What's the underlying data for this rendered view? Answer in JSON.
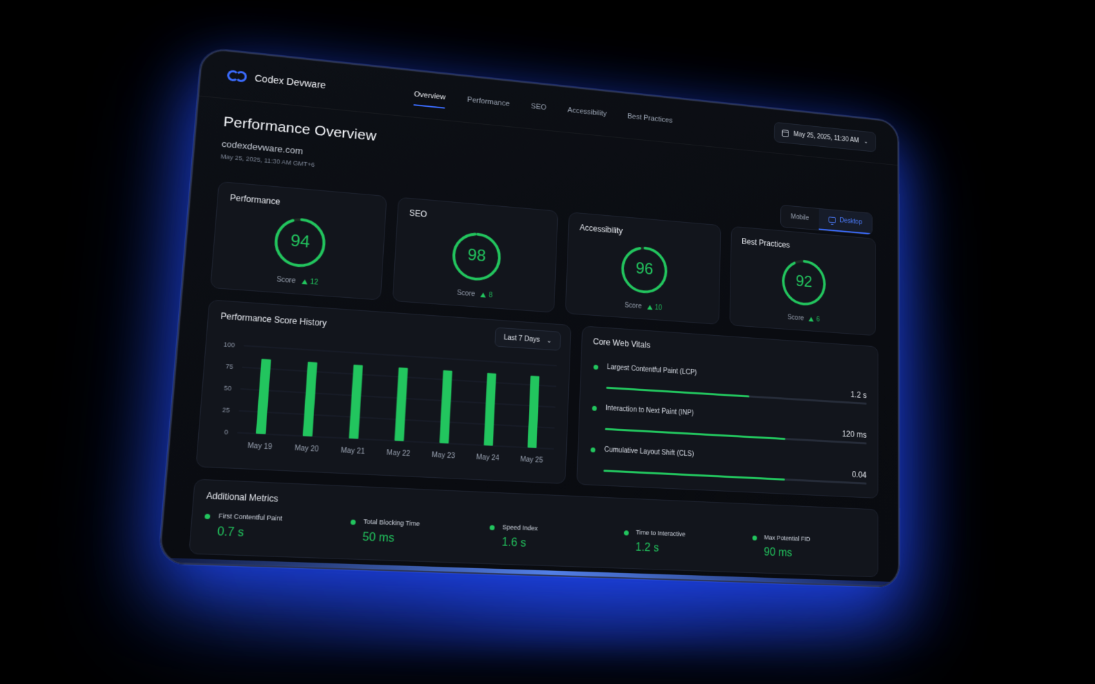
{
  "brand": {
    "name": "Codex Devware",
    "icon": "codex-logo-icon"
  },
  "nav": {
    "tabs": [
      {
        "label": "Overview",
        "active": true
      },
      {
        "label": "Performance",
        "active": false
      },
      {
        "label": "SEO",
        "active": false
      },
      {
        "label": "Accessibility",
        "active": false
      },
      {
        "label": "Best Practices",
        "active": false
      }
    ]
  },
  "date_picker": {
    "value": "May 25, 2025, 11:30 AM",
    "icon": "calendar-icon"
  },
  "header": {
    "title": "Performance Overview",
    "site": "codexdevware.com",
    "timestamp": "May 25, 2025, 11:30 AM GMT+6"
  },
  "device_toggle": {
    "mobile_label": "Mobile",
    "desktop_label": "Desktop",
    "selected": "Desktop"
  },
  "score_cards": [
    {
      "title": "Performance",
      "score": "94",
      "label": "Score",
      "delta": "12"
    },
    {
      "title": "SEO",
      "score": "98",
      "label": "Score",
      "delta": "8"
    },
    {
      "title": "Accessibility",
      "score": "96",
      "label": "Score",
      "delta": "10"
    },
    {
      "title": "Best Practices",
      "score": "92",
      "label": "Score",
      "delta": "6"
    }
  ],
  "history": {
    "title": "Performance Score History",
    "range": "Last 7 Days"
  },
  "chart_data": {
    "type": "bar",
    "title": "Performance Score History",
    "categories": [
      "May 19",
      "May 20",
      "May 21",
      "May 22",
      "May 23",
      "May 24",
      "May 25"
    ],
    "values": [
      86,
      86,
      86,
      86,
      86,
      86,
      86
    ],
    "ylim": [
      0,
      100
    ],
    "yticks": [
      0,
      25,
      50,
      75,
      100
    ],
    "xlabel": "",
    "ylabel": "",
    "color": "#22c55e",
    "grid": true
  },
  "vitals": {
    "title": "Core Web Vitals",
    "items": [
      {
        "label": "Largest Contentful Paint (LCP)",
        "value": "1.2 s",
        "fill": 0.54
      },
      {
        "label": "Interaction to Next Paint (INP)",
        "value": "120 ms",
        "fill": 0.68
      },
      {
        "label": "Cumulative Layout Shift (CLS)",
        "value": "0.04",
        "fill": 0.68
      }
    ]
  },
  "additional": {
    "title": "Additional Metrics",
    "items": [
      {
        "label": "First Contentful Paint",
        "value": "0.7 s"
      },
      {
        "label": "Total Blocking Time",
        "value": "50 ms"
      },
      {
        "label": "Speed Index",
        "value": "1.6 s"
      },
      {
        "label": "Time to Interactive",
        "value": "1.2 s"
      },
      {
        "label": "Max Potential FID",
        "value": "90 ms"
      }
    ]
  },
  "colors": {
    "accent": "#3b6cff",
    "good": "#22c55e",
    "surface": "#12151c"
  }
}
